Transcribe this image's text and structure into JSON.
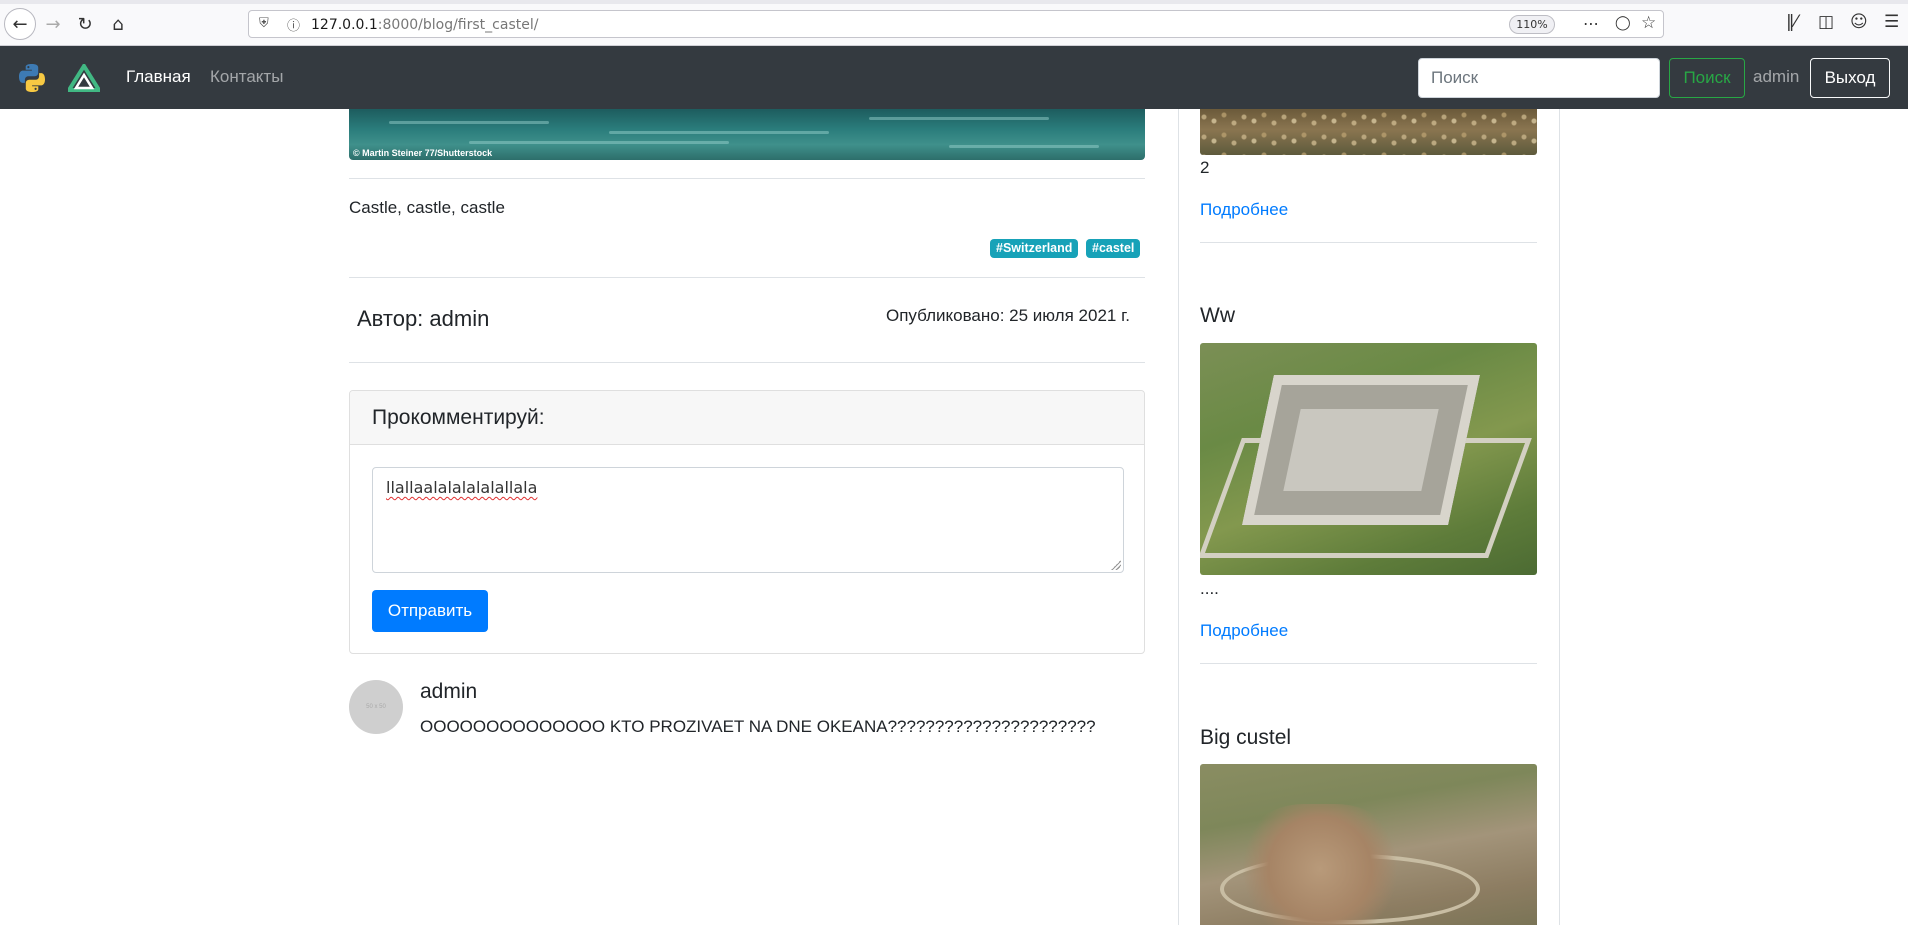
{
  "browser": {
    "url_host": "127.0.0.1",
    "url_rest": ":8000/blog/first_castel/",
    "zoom": "110%"
  },
  "navbar": {
    "home_label": "Главная",
    "contacts_label": "Контакты",
    "search_placeholder": "Поиск",
    "search_button": "Поиск",
    "username": "admin",
    "logout_label": "Выход"
  },
  "post": {
    "image_credit": "© Martin Steiner 77/Shutterstock",
    "text": "Castle, castle, castle",
    "tags": [
      "#Switzerland",
      "#castel"
    ],
    "author": "Автор: admin",
    "published": "Опубликовано: 25 июля 2021 г."
  },
  "comment_form": {
    "title": "Прокомментируй:",
    "textarea_value": "llallaalalalalalallala",
    "submit_label": "Отправить"
  },
  "comments": [
    {
      "avatar_text": "50 x 50",
      "user": "admin",
      "body": "OOOOOOOOOOOOOO KTO PROZIVAET NA DNE OKEANA??????????????????????"
    }
  ],
  "sidebar": {
    "items": [
      {
        "title": "",
        "text": "2",
        "link": "Подробнее"
      },
      {
        "title": "Ww",
        "text": "....",
        "link": "Подробнее"
      },
      {
        "title": "Big custel",
        "text": "",
        "link": ""
      }
    ]
  },
  "colors": {
    "navbar_bg": "#343a40",
    "primary": "#007bff",
    "success": "#28a745",
    "badge": "#17a2b8"
  }
}
